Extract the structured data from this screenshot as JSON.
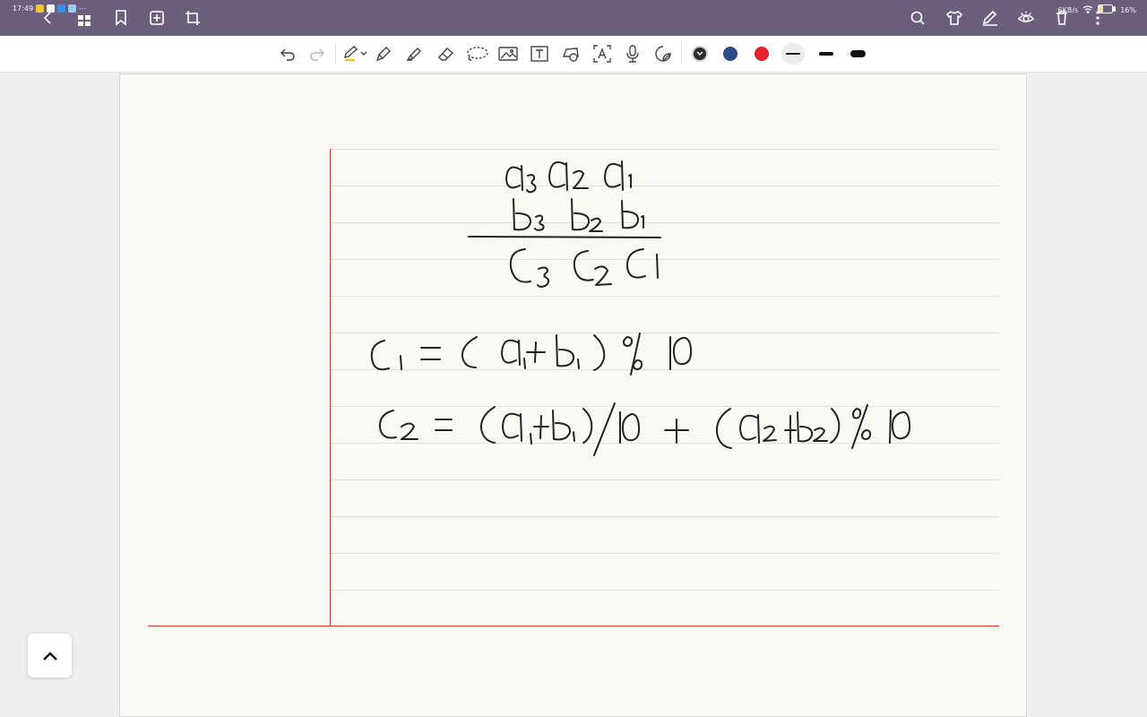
{
  "status_bar": {
    "time": "17:49",
    "network_speed": "6KB/s",
    "battery": "16%"
  },
  "top_bar": {
    "icons": [
      "back-icon",
      "bookmark-icon",
      "add-page-icon",
      "crop-icon",
      "search-icon",
      "theme-icon",
      "pen-mode-icon",
      "reading-mode-icon",
      "delete-icon",
      "more-icon"
    ]
  },
  "toolbar": {
    "tools": [
      "undo",
      "redo",
      "pen",
      "fountain-pen",
      "highlighter",
      "eraser",
      "lasso",
      "image",
      "text",
      "shape",
      "ocr-text",
      "microphone",
      "sticker"
    ],
    "colors": [
      "#2b2b2b",
      "#2f4a8a",
      "#e8212a"
    ],
    "thickness_options": [
      "thin",
      "medium",
      "thick"
    ]
  },
  "notebook": {
    "margin_color": "#dd3333",
    "paper_color": "#fbf9f4"
  }
}
